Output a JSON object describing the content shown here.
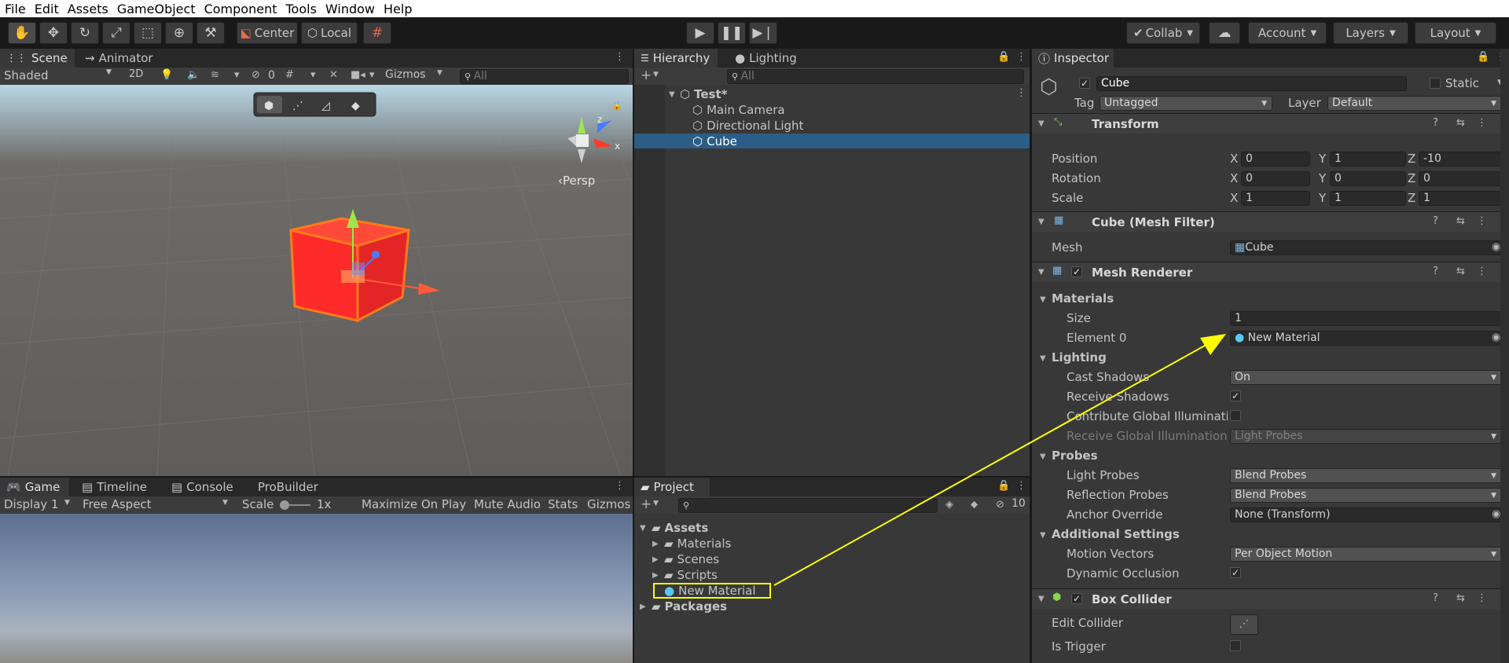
{
  "menu": [
    "File",
    "Edit",
    "Assets",
    "GameObject",
    "Component",
    "Tools",
    "Window",
    "Help"
  ],
  "toolbar": {
    "center_label": "Center",
    "local_label": "Local",
    "collab_label": "Collab",
    "account_label": "Account",
    "layers_label": "Layers",
    "layout_label": "Layout"
  },
  "scene": {
    "tabs": [
      "Scene",
      "Animator"
    ],
    "shading": "Shaded",
    "mode2d": "2D",
    "hidden_count": "0",
    "gizmos": "Gizmos",
    "search_placeholder": "All",
    "persp": "‹Persp",
    "axis_x": "x",
    "axis_z": "z"
  },
  "game": {
    "tabs": [
      "Game",
      "Timeline",
      "Console",
      "ProBuilder"
    ],
    "display": "Display 1",
    "aspect": "Free Aspect",
    "scale_label": "Scale",
    "scale_value": "1x",
    "maximize": "Maximize On Play",
    "mute": "Mute Audio",
    "stats": "Stats",
    "gizmos": "Gizmos"
  },
  "hierarchy": {
    "tabs": [
      "Hierarchy",
      "Lighting"
    ],
    "search_placeholder": "All",
    "scene_name": "Test*",
    "items": [
      "Main Camera",
      "Directional Light",
      "Cube"
    ]
  },
  "project": {
    "tab": "Project",
    "hidden_count": "10",
    "assets": "Assets",
    "folders": [
      "Materials",
      "Scenes",
      "Scripts"
    ],
    "material": "New Material",
    "packages": "Packages"
  },
  "inspector": {
    "tab": "Inspector",
    "object_name": "Cube",
    "static_label": "Static",
    "tag_label": "Tag",
    "tag_value": "Untagged",
    "layer_label": "Layer",
    "layer_value": "Default",
    "transform": {
      "title": "Transform",
      "position_label": "Position",
      "rotation_label": "Rotation",
      "scale_label": "Scale",
      "position": {
        "x": "0",
        "y": "1",
        "z": "-10"
      },
      "rotation": {
        "x": "0",
        "y": "0",
        "z": "0"
      },
      "scale": {
        "x": "1",
        "y": "1",
        "z": "1"
      },
      "x": "X",
      "y": "Y",
      "z": "Z"
    },
    "mesh_filter": {
      "title": "Cube (Mesh Filter)",
      "mesh_label": "Mesh",
      "mesh_value": "Cube"
    },
    "mesh_renderer": {
      "title": "Mesh Renderer",
      "materials": "Materials",
      "size_label": "Size",
      "size_value": "1",
      "element0_label": "Element 0",
      "element0_value": "New Material",
      "lighting": "Lighting",
      "cast_shadows_label": "Cast Shadows",
      "cast_shadows_value": "On",
      "receive_shadows_label": "Receive Shadows",
      "contribute_gi_label": "Contribute Global Illuminatio",
      "receive_gi_label": "Receive Global Illumination",
      "receive_gi_value": "Light Probes",
      "probes": "Probes",
      "light_probes_label": "Light Probes",
      "light_probes_value": "Blend Probes",
      "reflection_probes_label": "Reflection Probes",
      "reflection_probes_value": "Blend Probes",
      "anchor_override_label": "Anchor Override",
      "anchor_override_value": "None (Transform)",
      "additional": "Additional Settings",
      "motion_vectors_label": "Motion Vectors",
      "motion_vectors_value": "Per Object Motion",
      "dynamic_occlusion_label": "Dynamic Occlusion"
    },
    "box_collider": {
      "title": "Box Collider",
      "edit_collider_label": "Edit Collider",
      "is_trigger_label": "Is Trigger"
    }
  },
  "colors": {
    "selection": "#2c5d87",
    "annotation": "#ffff00",
    "cube": "#ff2b2b"
  }
}
